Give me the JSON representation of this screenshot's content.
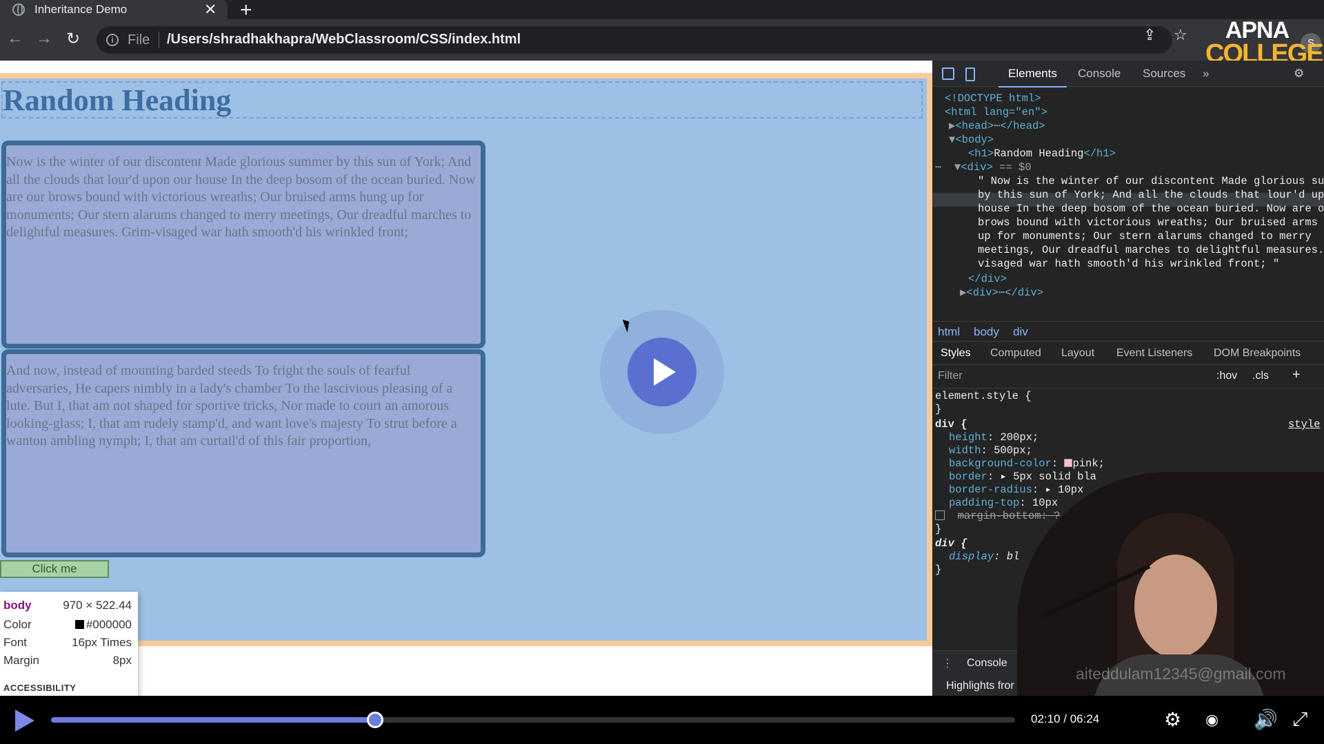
{
  "browser": {
    "tab_title": "Inheritance Demo",
    "tab_close": "✕",
    "new_tab": "+",
    "scheme_label": "File",
    "url": "/Users/shradhakhapra/WebClassroom/CSS/index.html",
    "profile_initial": "S",
    "logo_line1": "APNA",
    "logo_line2": "COLLEGE"
  },
  "page": {
    "heading": "Random Heading",
    "div1_text": "Now is the winter of our discontent Made glorious summer by this sun of York; And all the clouds that lour'd upon our house In the deep bosom of the ocean buried. Now are our brows bound with victorious wreaths; Our bruised arms hung up for monuments; Our stern alarums changed to merry meetings, Our dreadful marches to delightful measures. Grim-visaged war hath smooth'd his wrinkled front;",
    "div2_text": "And now, instead of mounting barded steeds To fright the souls of fearful adversaries, He capers nimbly in a lady's chamber To the lascivious pleasing of a lute. But I, that am not shaped for sportive tricks, Nor made to court an amorous looking-glass; I, that am rudely stamp'd, and want love's majesty To strut before a wanton ambling nymph; I, that am curtail'd of this fair proportion,",
    "button_label": "Click me"
  },
  "tooltip": {
    "tag": "body",
    "size": "970 × 522.44",
    "color_label": "Color",
    "color_value": "#000000",
    "font_label": "Font",
    "font_value": "16px Times",
    "margin_label": "Margin",
    "margin_value": "8px",
    "accessibility": "ACCESSIBILITY"
  },
  "devtools": {
    "tabs": [
      "Elements",
      "Console",
      "Sources",
      "»"
    ],
    "dom": {
      "doctype": "<!DOCTYPE html>",
      "html_open": "<html lang=\"en\">",
      "head": "<head>",
      "head_close": "</head>",
      "body": "<body>",
      "h1_open": "<h1>",
      "h1_text": "Random Heading",
      "h1_close": "</h1>",
      "div_open": "<div>",
      "div_marker": "== $0",
      "text_lines": [
        "\" Now is the winter of our discontent Made glorious sum",
        "by this sun of York; And all the clouds that lour'd upo",
        "house In the deep bosom of the ocean buried. Now are ou",
        "brows bound with victorious wreaths; Our bruised arms h",
        "up for monuments; Our stern alarums changed to merry",
        "meetings, Our dreadful marches to delightful measures.",
        "visaged war hath smooth'd his wrinkled front; \""
      ],
      "div_close": "</div>",
      "div2_open": "<div>",
      "div2_close": "</div>"
    },
    "breadcrumbs": [
      "html",
      "body",
      "div"
    ],
    "sub_tabs": [
      "Styles",
      "Computed",
      "Layout",
      "Event Listeners",
      "DOM Breakpoints"
    ],
    "filter_placeholder": "Filter",
    "filter_hov": ":hov",
    "filter_cls": ".cls",
    "filter_plus": "+",
    "styles": {
      "element_style": "element.style {",
      "close": "}",
      "div_rule": "div {",
      "source": "style",
      "props": [
        {
          "name": "height",
          "value": "200px;"
        },
        {
          "name": "width",
          "value": "500px;"
        },
        {
          "name": "background-color",
          "value": "pink;"
        },
        {
          "name": "border",
          "value": "5px solid bla"
        },
        {
          "name": "border-radius",
          "value": "10px"
        },
        {
          "name": "padding-top",
          "value": "10px"
        },
        {
          "name": "margin-bottom",
          "value": "?"
        }
      ],
      "div_rule2": "div {",
      "ua_prop": "display",
      "ua_value": "bl"
    },
    "drawer_tab": "Console",
    "drawer_line": "Highlights fror"
  },
  "watermark": "aiteddulam12345@gmail.com",
  "player": {
    "time": "02:10 / 06:24",
    "progress": 0.336
  }
}
